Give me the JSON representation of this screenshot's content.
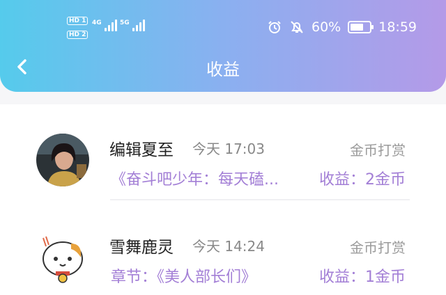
{
  "status_bar": {
    "hd1": "HD 1",
    "hd2": "HD 2",
    "net1": "4G",
    "net2": "5G",
    "battery": "60%",
    "time": "18:59"
  },
  "header": {
    "title": "收益"
  },
  "records": [
    {
      "name": "编辑夏至",
      "time": "今天 17:03",
      "type": "金币打赏",
      "desc": "《奋斗吧少年：每天磕...",
      "earning": "收益：2金币"
    },
    {
      "name": "雪舞鹿灵",
      "time": "今天 14:24",
      "type": "金币打赏",
      "desc": "章节：《美人部长们》",
      "earning": "收益：1金币"
    }
  ],
  "colors": {
    "accent": "#a37fd6",
    "header_start": "#55cbec",
    "header_end": "#b49ae8"
  }
}
